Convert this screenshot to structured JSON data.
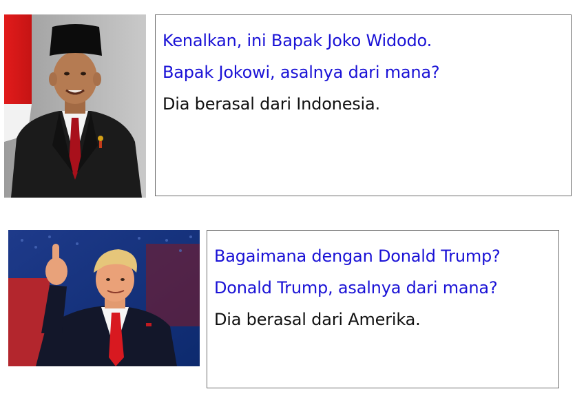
{
  "colors": {
    "question": "#1a12d6",
    "answer": "#111111",
    "border": "#6b6b6b"
  },
  "panels": [
    {
      "photo_subject": "Joko Widodo portrait",
      "question1": "Kenalkan, ini Bapak Joko Widodo.",
      "question2": "Bapak Jokowi, asalnya dari mana?",
      "answer": "Dia berasal dari Indonesia."
    },
    {
      "photo_subject": "Donald Trump thumbs up",
      "question1": "Bagaimana dengan Donald Trump?",
      "question2": "Donald Trump, asalnya dari mana?",
      "answer": "Dia berasal dari Amerika."
    }
  ]
}
